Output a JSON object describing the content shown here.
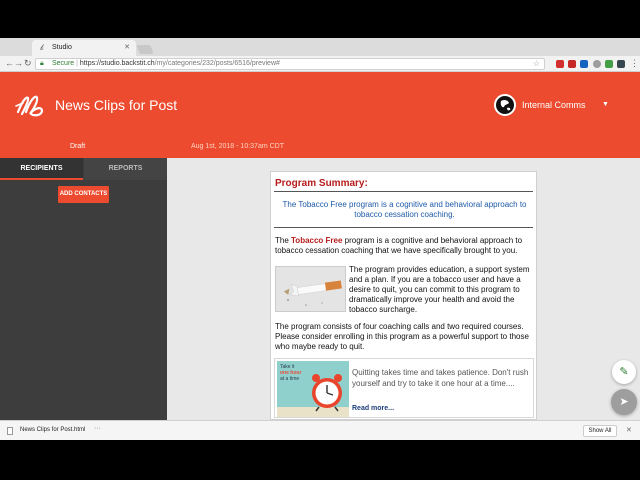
{
  "browser": {
    "tab_title": "Studio",
    "url_secure": "Secure",
    "url_host": "https://studio.backstit.ch",
    "url_path": "/my/categories/232/posts/6516/preview#",
    "favicon": "backstitch-logo-icon"
  },
  "header": {
    "title": "News Clips for Post",
    "workspace": "Internal Comms",
    "status": "Draft",
    "date": "Aug 1st, 2018 - 10:37am CDT",
    "accent_color": "#ec4b2f"
  },
  "sidebar": {
    "tabs": [
      {
        "label": "RECIPIENTS",
        "active": true
      },
      {
        "label": "REPORTS",
        "active": false
      }
    ],
    "add_contacts_label": "ADD CONTACTS"
  },
  "preview": {
    "title": "Program Summary:",
    "intro": "The Tobacco Free program is a cognitive and behavioral approach to tobacco cessation coaching.",
    "para1_pre": "The ",
    "para1_hl": "Tobacco Free",
    "para1_post": " program is a cognitive and behavioral approach to tobacco cessation coaching that we have specifically brought to you.",
    "para2": "The program provides education, a support system and a plan. If you are a tobacco user and have a desire to quit, you can commit to this program to dramatically improve your health and avoid the tobacco surcharge.",
    "para3": "The program consists of four coaching calls and two required courses. Please consider enrolling in this program as a powerful support to those who maybe ready to quit.",
    "thumb2_line1": "Take it",
    "thumb2_line2": "one hour",
    "thumb2_line3": "at a time",
    "quote": "Quitting takes time and takes patience. Don't rush yourself and try to take it one hour at a time....",
    "read_more": "Read more..."
  },
  "downloads": {
    "file_name": "News Clips for Post.html",
    "more": "···",
    "show_all": "Show All",
    "close": "✕"
  }
}
